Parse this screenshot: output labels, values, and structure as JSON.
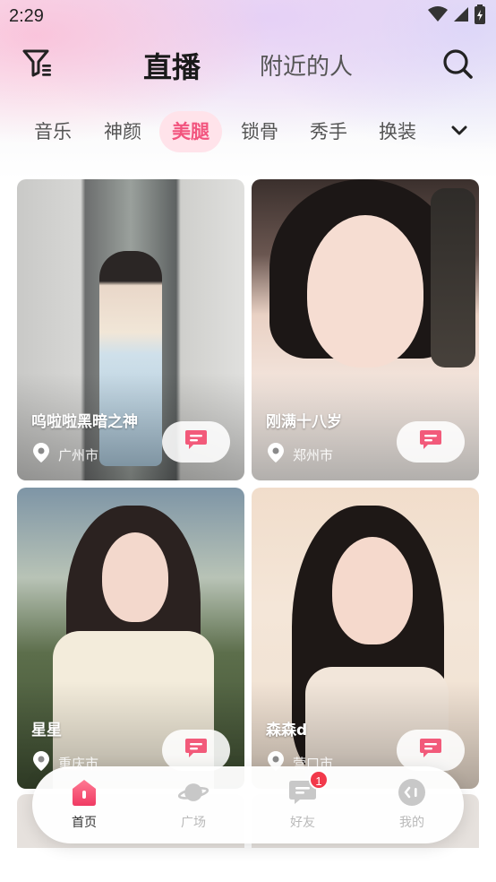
{
  "status": {
    "time": "2:29"
  },
  "header": {
    "tabs": [
      {
        "label": "直播",
        "active": true
      },
      {
        "label": "附近的人",
        "active": false
      }
    ],
    "filter_icon": "filter-icon",
    "search_icon": "search-icon"
  },
  "categories": {
    "items": [
      "音乐",
      "神颜",
      "美腿",
      "锁骨",
      "秀手",
      "换装"
    ],
    "active": "美腿",
    "more_icon": "chevron-down-icon"
  },
  "cards": [
    {
      "name": "呜啦啦黑暗之神",
      "location": "广州市"
    },
    {
      "name": "刚满十八岁",
      "location": "郑州市"
    },
    {
      "name": "星星",
      "location": "重庆市"
    },
    {
      "name": "森森d",
      "location": "营口市"
    }
  ],
  "bottom_nav": {
    "items": [
      {
        "label": "首页",
        "icon": "home-icon",
        "active": true
      },
      {
        "label": "广场",
        "icon": "planet-icon",
        "active": false
      },
      {
        "label": "好友",
        "icon": "message-icon",
        "active": false,
        "badge": "1"
      },
      {
        "label": "我的",
        "icon": "profile-icon",
        "active": false
      }
    ]
  },
  "colors": {
    "accent": "#f2547e",
    "badge": "#f2394b"
  }
}
